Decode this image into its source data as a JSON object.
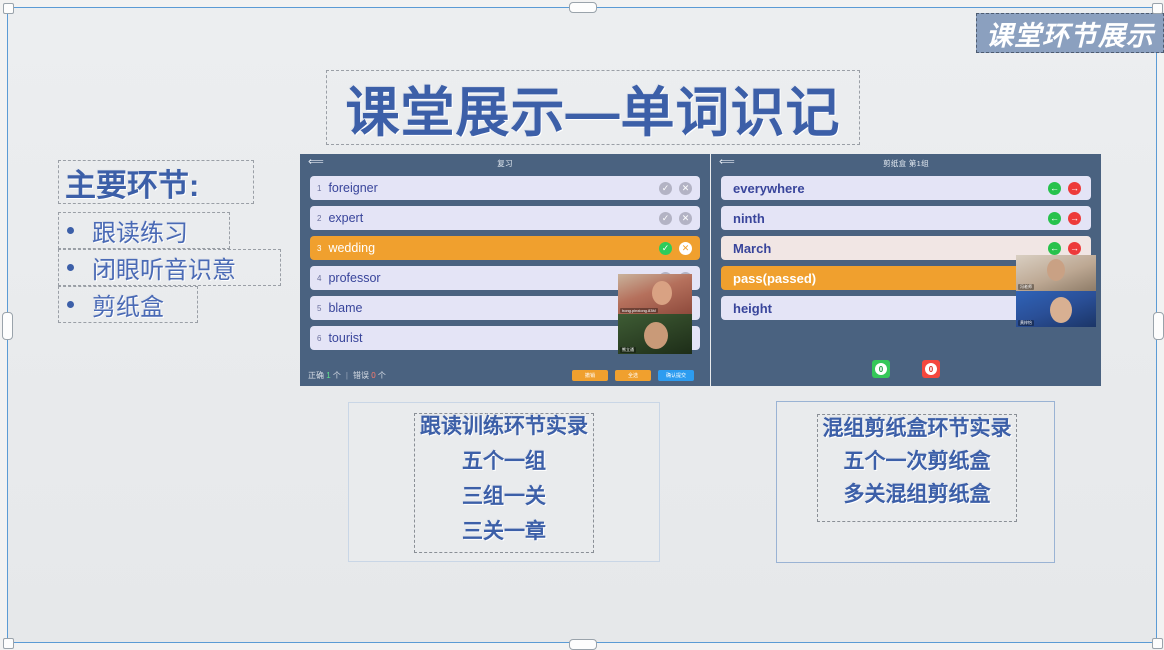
{
  "slide": {
    "badge_label": "课堂环节展示",
    "title": "课堂展示—单词识记",
    "agenda": {
      "heading": "主要环节:",
      "items": [
        {
          "label": "跟读练习"
        },
        {
          "label": "闭眼听音识意"
        },
        {
          "label": "剪纸盒"
        }
      ]
    },
    "colors": {
      "accent_blue": "#3c5fa8",
      "badge_bg": "#8ba0bf",
      "app_bg": "#4a6280",
      "row_lavender": "#e4e4f6",
      "row_active_orange": "#f0a02e",
      "row_pink": "#f1e6e4",
      "green": "#2ecc5b",
      "red": "#ed3a3a"
    }
  },
  "app_left": {
    "back_icon": "back-arrow-icon",
    "title": "复习",
    "rows": [
      {
        "num": "1",
        "word": "foreigner",
        "state": "default"
      },
      {
        "num": "2",
        "word": "expert",
        "state": "default"
      },
      {
        "num": "3",
        "word": "wedding",
        "state": "active"
      },
      {
        "num": "4",
        "word": "professor",
        "state": "default"
      },
      {
        "num": "5",
        "word": "blame",
        "state": "default"
      },
      {
        "num": "6",
        "word": "tourist",
        "state": "default"
      }
    ],
    "status": {
      "correct_label": "正确",
      "correct_count": "1",
      "unit": "个",
      "separator": "|",
      "wrong_label": "错误",
      "wrong_count": "0"
    },
    "buttons": [
      {
        "label": "撤销",
        "color": "orange"
      },
      {
        "label": "全选",
        "color": "orange"
      },
      {
        "label": "确认提交",
        "color": "blue"
      }
    ],
    "videos": [
      {
        "name": "hong.pinxiong.83M"
      },
      {
        "name": "熊立通"
      }
    ]
  },
  "app_right": {
    "back_icon": "back-arrow-icon",
    "title": "剪纸盒 第1组",
    "rows": [
      {
        "word": "everywhere",
        "state": "default"
      },
      {
        "word": "ninth",
        "state": "default"
      },
      {
        "word": "March",
        "state": "pink"
      },
      {
        "word": "pass(passed)",
        "state": "active"
      },
      {
        "word": "height",
        "state": "default"
      }
    ],
    "counters": {
      "correct": "0",
      "wrong": "0"
    },
    "videos": [
      {
        "name": "冯老师"
      },
      {
        "name": "黄梓怡"
      }
    ]
  },
  "caption_left": {
    "lines": [
      "跟读训练环节实录",
      "五个一组",
      "三组一关",
      "三关一章"
    ]
  },
  "caption_right": {
    "lines": [
      "混组剪纸盒环节实录",
      "五个一次剪纸盒",
      "多关混组剪纸盒"
    ]
  }
}
